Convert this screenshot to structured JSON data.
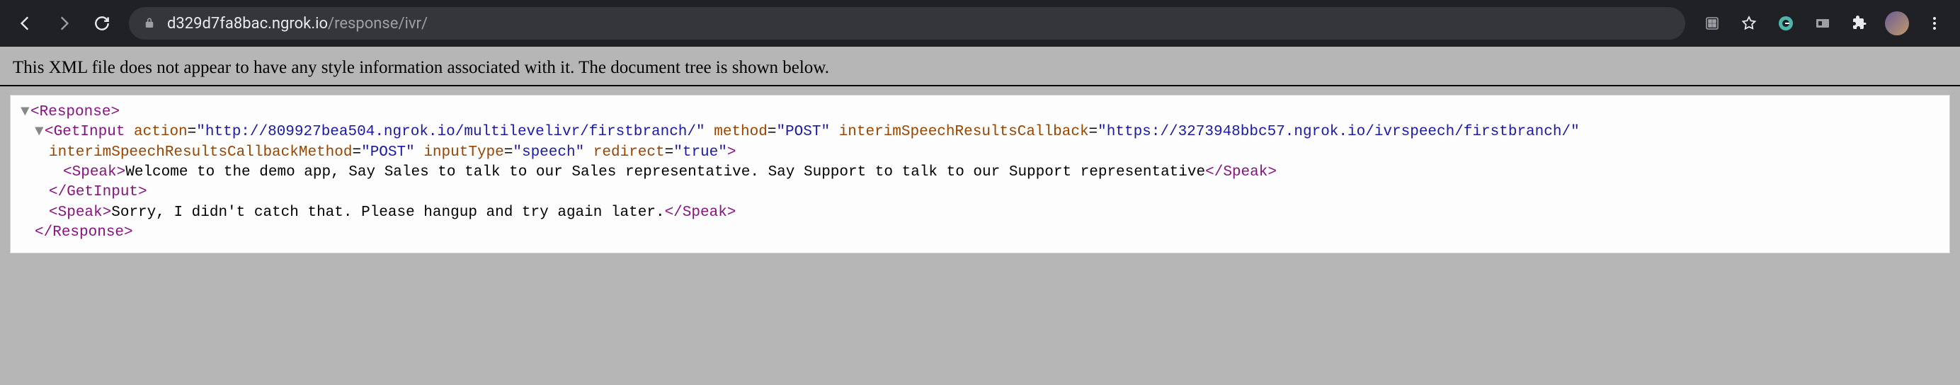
{
  "browser": {
    "url_host": "d329d7fa8bac.ngrok.io",
    "url_path": "/response/ivr/"
  },
  "hint": "This XML file does not appear to have any style information associated with it. The document tree is shown below.",
  "xml": {
    "root_open": "Response",
    "root_close": "Response",
    "getinput": {
      "name_open": "GetInput",
      "name_close": "GetInput",
      "attrs": {
        "action_name": "action",
        "action_val": "\"http://809927bea504.ngrok.io/multilevelivr/firstbranch/\"",
        "method_name": "method",
        "method_val": "\"POST\"",
        "isrc_name": "interimSpeechResultsCallback",
        "isrc_val": "\"https://3273948bbc57.ngrok.io/ivrspeech/firstbranch/\"",
        "isrcm_name": "interimSpeechResultsCallbackMethod",
        "isrcm_val": "\"POST\"",
        "itype_name": "inputType",
        "itype_val": "\"speech\"",
        "redirect_name": "redirect",
        "redirect_val": "\"true\""
      },
      "speak_tag": "Speak",
      "speak_text": "Welcome to the demo app, Say Sales to talk to our Sales representative. Say Support to talk to our Support representative"
    },
    "speak2_tag": "Speak",
    "speak2_text": "Sorry, I didn't catch that. Please hangup and try again later."
  },
  "glyphs": {
    "arrow": "▼",
    "lt": "<",
    "gt": ">",
    "lts": "</",
    "eq": "="
  }
}
